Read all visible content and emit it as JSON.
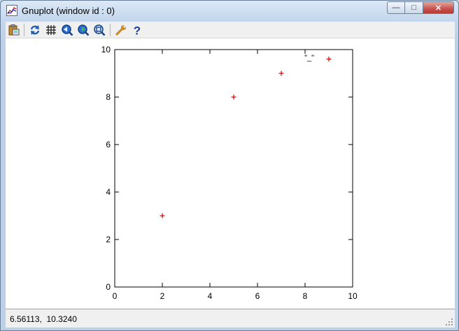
{
  "window": {
    "title": "Gnuplot (window id : 0)",
    "controls": {
      "minimize": "—",
      "maximize": "□",
      "close": "✕"
    }
  },
  "toolbar": {
    "buttons": [
      {
        "name": "copy-to-clipboard",
        "icon": "clipboard-icon"
      },
      {
        "name": "replot",
        "icon": "refresh-icon"
      },
      {
        "name": "grid",
        "icon": "grid-icon"
      },
      {
        "name": "zoom-back",
        "icon": "zoom-back-icon"
      },
      {
        "name": "zoom-forward",
        "icon": "zoom-forward-icon"
      },
      {
        "name": "autoscale",
        "icon": "autoscale-icon"
      },
      {
        "name": "options",
        "icon": "wrench-icon"
      },
      {
        "name": "help",
        "icon": "help-icon"
      }
    ]
  },
  "status": {
    "coordinates": "6.56113,  10.3240"
  },
  "colors": {
    "point": "#cc0000",
    "title_bar": "#c3d6ec",
    "panel": "#f0f0f0"
  },
  "chart_data": {
    "type": "scatter",
    "title": "",
    "xlabel": "",
    "ylabel": "",
    "xlim": [
      0,
      10
    ],
    "ylim": [
      0,
      10
    ],
    "xticks": [
      "0",
      "2",
      "4",
      "6",
      "8",
      "10"
    ],
    "yticks": [
      "0",
      "2",
      "4",
      "6",
      "8",
      "10"
    ],
    "legend_position": "top-right",
    "series": [
      {
        "name": "\"_\"",
        "color": "#cc0000",
        "marker": "+",
        "points": [
          {
            "x": 2,
            "y": 3
          },
          {
            "x": 5,
            "y": 8
          },
          {
            "x": 7,
            "y": 9
          },
          {
            "x": 9,
            "y": 9.6
          }
        ]
      }
    ]
  }
}
